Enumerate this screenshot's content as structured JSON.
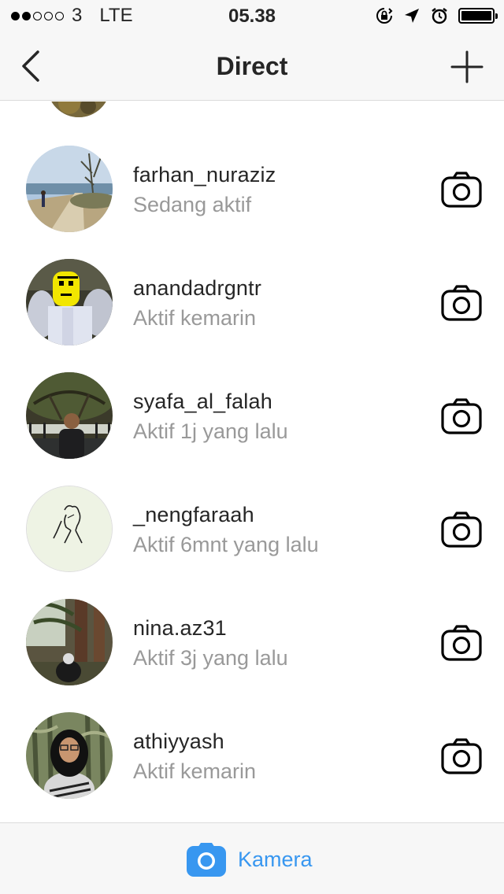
{
  "status_bar": {
    "carrier": "3",
    "network": "LTE",
    "time": "05.38"
  },
  "nav": {
    "title": "Direct",
    "back_icon": "chevron-left-icon",
    "add_icon": "plus-icon"
  },
  "conversations": [
    {
      "username": "farhan_nuraziz",
      "activity": "Sedang aktif"
    },
    {
      "username": "anandadrgntr",
      "activity": "Aktif kemarin"
    },
    {
      "username": "syafa_al_falah",
      "activity": "Aktif 1j yang lalu"
    },
    {
      "username": "_nengfaraah",
      "activity": "Aktif 6mnt yang lalu"
    },
    {
      "username": "nina.az31",
      "activity": "Aktif 3j yang lalu"
    },
    {
      "username": "athiyyash",
      "activity": "Aktif kemarin"
    }
  ],
  "bottom": {
    "camera_label": "Kamera"
  },
  "colors": {
    "accent": "#3897f0",
    "text_primary": "#262626",
    "text_secondary": "#999999",
    "bar_background": "#f7f7f7"
  }
}
